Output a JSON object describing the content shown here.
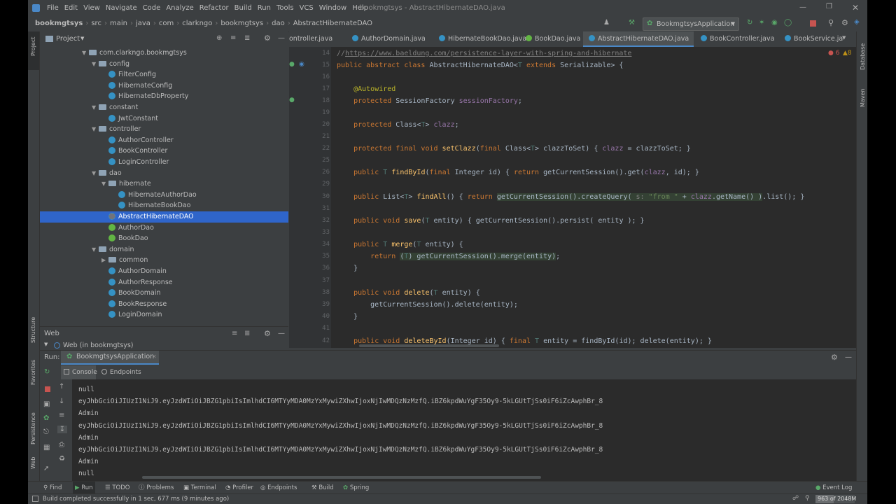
{
  "window": {
    "title": "bookmgtsys - AbstractHibernateDAO.java"
  },
  "menu": [
    "File",
    "Edit",
    "View",
    "Navigate",
    "Code",
    "Analyze",
    "Refactor",
    "Build",
    "Run",
    "Tools",
    "VCS",
    "Window",
    "Help"
  ],
  "breadcrumbs": [
    "bookmgtsys",
    "src",
    "main",
    "java",
    "com",
    "clarkngo",
    "bookmgtsys",
    "dao",
    "AbstractHibernateDAO"
  ],
  "run_config": "BookmgtsysApplication",
  "project_panel": {
    "title": "Project"
  },
  "tree": [
    {
      "label": "com.clarkngo.bookmgtsys",
      "type": "folder",
      "indent": 0,
      "open": true
    },
    {
      "label": "config",
      "type": "folder",
      "indent": 1,
      "open": true
    },
    {
      "label": "FilterConfig",
      "type": "class",
      "indent": 2
    },
    {
      "label": "HibernateConfig",
      "type": "class",
      "indent": 2
    },
    {
      "label": "HibernateDbProperty",
      "type": "class",
      "indent": 2
    },
    {
      "label": "constant",
      "type": "folder",
      "indent": 1,
      "open": true
    },
    {
      "label": "JwtConstant",
      "type": "class",
      "indent": 2
    },
    {
      "label": "controller",
      "type": "folder",
      "indent": 1,
      "open": true
    },
    {
      "label": "AuthorController",
      "type": "class",
      "indent": 2
    },
    {
      "label": "BookController",
      "type": "class",
      "indent": 2
    },
    {
      "label": "LoginController",
      "type": "class",
      "indent": 2
    },
    {
      "label": "dao",
      "type": "folder",
      "indent": 1,
      "open": true
    },
    {
      "label": "hibernate",
      "type": "folder",
      "indent": 2,
      "open": true
    },
    {
      "label": "HibernateAuthorDao",
      "type": "class",
      "indent": 3
    },
    {
      "label": "HibernateBookDao",
      "type": "class",
      "indent": 3
    },
    {
      "label": "AbstractHibernateDAO",
      "type": "abstract",
      "indent": 2,
      "selected": true
    },
    {
      "label": "AuthorDao",
      "type": "interface",
      "indent": 2
    },
    {
      "label": "BookDao",
      "type": "interface",
      "indent": 2
    },
    {
      "label": "domain",
      "type": "folder",
      "indent": 1,
      "open": true
    },
    {
      "label": "common",
      "type": "folder",
      "indent": 2,
      "open": false
    },
    {
      "label": "AuthorDomain",
      "type": "class",
      "indent": 2
    },
    {
      "label": "AuthorResponse",
      "type": "class",
      "indent": 2
    },
    {
      "label": "BookDomain",
      "type": "class",
      "indent": 2
    },
    {
      "label": "BookResponse",
      "type": "class",
      "indent": 2
    },
    {
      "label": "LoginDomain",
      "type": "class",
      "indent": 2
    }
  ],
  "web_panel": {
    "title": "Web",
    "item": "Web (in bookmgtsys)"
  },
  "editor_tabs": [
    "ontroller.java",
    "AuthorDomain.java",
    "HibernateBookDao.java",
    "BookDao.java",
    "AbstractHibernateDAO.java",
    "BookController.java",
    "BookService.ja"
  ],
  "editor_active_tab": 4,
  "inspections": {
    "errors": "6",
    "warnings": "8"
  },
  "code": [
    {
      "ln": "14",
      "html": "<span class=\"cmt\">//<u>https://www.baeldung.com/persistence-layer-with-spring-and-hibernate</u></span>"
    },
    {
      "ln": "15",
      "html": "<span class=\"kw\">public abstract class</span> AbstractHibernateDAO&lt;<span class=\"tp\">T</span> <span class=\"kw\">extends</span> Serializable&gt; {"
    },
    {
      "ln": "16",
      "html": ""
    },
    {
      "ln": "17",
      "html": "    <span class=\"ann\">@Autowired</span>"
    },
    {
      "ln": "18",
      "html": "    <span class=\"kw\">protected</span> SessionFactory <span class=\"fld\">sessionFactory</span>;"
    },
    {
      "ln": "19",
      "html": ""
    },
    {
      "ln": "20",
      "html": "    <span class=\"kw\">protected</span> Class&lt;<span class=\"tp\">T</span>&gt; <span class=\"fld\">clazz</span>;"
    },
    {
      "ln": "21",
      "html": ""
    },
    {
      "ln": "22",
      "html": "    <span class=\"kw\">protected final void</span> <span class=\"fn\">setClazz</span>(<span class=\"kw\">final</span> Class&lt;<span class=\"tp\">T</span>&gt; clazzToSet) { <span class=\"fld\">clazz</span> = clazzToSet; }"
    },
    {
      "ln": "25",
      "html": ""
    },
    {
      "ln": "26",
      "html": "    <span class=\"kw\">public</span> <span class=\"tp\">T</span> <span class=\"fn\">findById</span>(<span class=\"kw\">final</span> Integer id) { <span class=\"kw\">return</span> getCurrentSession().get(<span class=\"fld\">clazz</span>, id); }"
    },
    {
      "ln": "29",
      "html": ""
    },
    {
      "ln": "30",
      "html": "    <span class=\"kw\">public</span> List&lt;<span class=\"tp\">T</span>&gt; <span class=\"fn\">findAll</span>() { <span class=\"kw\">return</span> <span class=\"hl\">getCurrentSession().createQuery( <span class=\"cmt\">s:</span> <span class=\"str\">\"from \"</span> + <span class=\"fld\">clazz</span>.getName() )</span>.list(); }"
    },
    {
      "ln": "31",
      "html": ""
    },
    {
      "ln": "32",
      "html": "    <span class=\"kw\">public void</span> <span class=\"fn\">save</span>(<span class=\"tp\">T</span> entity) { getCurrentSession().persist( entity ); }"
    },
    {
      "ln": "33",
      "html": ""
    },
    {
      "ln": "34",
      "html": "    <span class=\"kw\">public</span> <span class=\"tp\">T</span> <span class=\"fn\">merge</span>(<span class=\"tp\">T</span> entity) {"
    },
    {
      "ln": "35",
      "html": "        <span class=\"kw\">return</span> <span class=\"hl\">(<span class=\"tp\">T</span>) getCurrentSession().merge(entity)</span>;"
    },
    {
      "ln": "36",
      "html": "    }"
    },
    {
      "ln": "37",
      "html": ""
    },
    {
      "ln": "38",
      "html": "    <span class=\"kw\">public void</span> <span class=\"fn\">delete</span>(<span class=\"tp\">T</span> entity) {"
    },
    {
      "ln": "39",
      "html": "        getCurrentSession().delete(entity);"
    },
    {
      "ln": "40",
      "html": "    }"
    },
    {
      "ln": "41",
      "html": ""
    },
    {
      "ln": "42",
      "html": "    <span class=\"kw\">public void</span> <span class=\"fn\">deleteById</span>(Integer id) { <span class=\"kw\">final</span> <span class=\"tp\">T</span> entity = findById(id); delete(entity); }"
    }
  ],
  "run_panel": {
    "label": "Run:",
    "config": "BookmgtsysApplication",
    "tabs": [
      "Console",
      "Endpoints"
    ]
  },
  "console_lines": [
    "null",
    "eyJhbGciOiJIUzI1NiJ9.eyJzdWIiOiJBZG1pbiIsImlhdCI6MTYyMDA0MzYxMywiZXhwIjoxNjIwMDQzNzMzfQ.iBZ6kpdWuYgF35Oy9-5kLGUtTjSs0iF6iZcAwphBr_8",
    "Admin",
    "eyJhbGciOiJIUzI1NiJ9.eyJzdWIiOiJBZG1pbiIsImlhdCI6MTYyMDA0MzYxMywiZXhwIjoxNjIwMDQzNzMzfQ.iBZ6kpdWuYgF35Oy9-5kLGUtTjSs0iF6iZcAwphBr_8",
    "Admin",
    "eyJhbGciOiJIUzI1NiJ9.eyJzdWIiOiJBZG1pbiIsImlhdCI6MTYyMDA0MzYxMywiZXhwIjoxNjIwMDQzNzMzfQ.iBZ6kpdWuYgF35Oy9-5kLGUtTjSs0iF6iZcAwphBr_8",
    "Admin",
    "null"
  ],
  "bottom_tools": [
    "Find",
    "Run",
    "TODO",
    "Problems",
    "Terminal",
    "Profiler",
    "Endpoints",
    "Build",
    "Spring"
  ],
  "event_log": "Event Log",
  "status": {
    "message": "Build completed successfully in 1 sec, 677 ms (9 minutes ago)",
    "memory": "963 of 2048M"
  },
  "left_strip": [
    "Project",
    "Structure",
    "Favorites",
    "Persistence",
    "Web"
  ],
  "right_strip": [
    "Database",
    "Maven"
  ]
}
